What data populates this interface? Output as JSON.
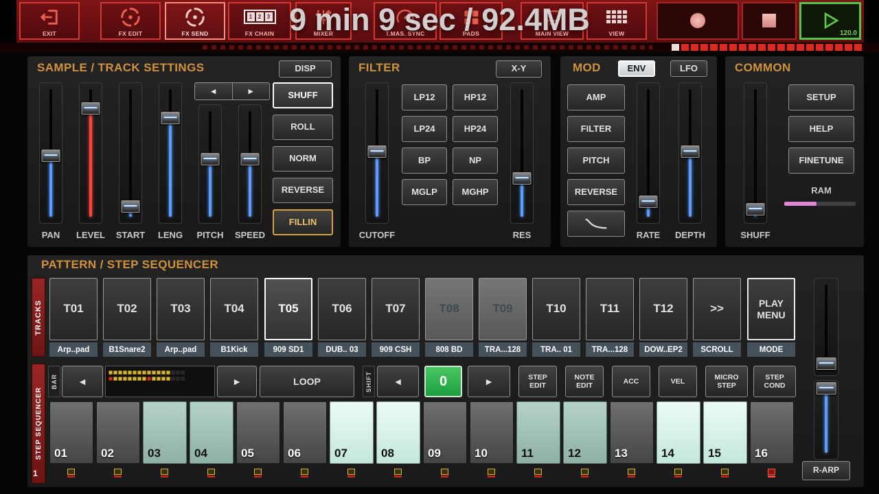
{
  "overlay_text": "9 min 9 sec / 92.4MB",
  "icons": {
    "prev": "◄",
    "next": "►"
  },
  "colors": {
    "accent_orange": "#d0923c",
    "fader_blue": "#5a9cff",
    "level_red": "#ff4438",
    "step_lit": "#d9f3ec",
    "play_green": "#58c24a",
    "ram_pink": "#df86d2",
    "seq_red": "#8e1f1f"
  },
  "toolbar": {
    "buttons": [
      {
        "label": "EXIT",
        "icon": "exit-icon"
      },
      {
        "label": "FX EDIT",
        "icon": "fx-spiral-icon"
      },
      {
        "label": "FX SEND",
        "icon": "fx-spiral-icon",
        "state": "active"
      },
      {
        "label": "FX CHAIN",
        "icon": "fx-chain-123-icon"
      },
      {
        "label": "MIXER",
        "icon": "mixer-faders-icon"
      },
      {
        "label": "T.MAS. SYNC",
        "icon": "gauge-icon"
      },
      {
        "label": "PADS",
        "icon": "pads-grid-icon"
      },
      {
        "label": "MAIN VIEW",
        "icon": "monitor-icon"
      },
      {
        "label": "VIEW",
        "icon": "view-grid-icon"
      }
    ],
    "play": {
      "bpm": "120.0"
    }
  },
  "sample": {
    "title": "SAMPLE / TRACK SETTINGS",
    "disp_label": "DISP",
    "faders": [
      {
        "label": "PAN",
        "pos": 52,
        "color": "#5a9cff"
      },
      {
        "label": "LEVEL",
        "pos": 18,
        "color": "#ff4438"
      },
      {
        "label": "START",
        "pos": 88,
        "color": "#5a9cff"
      },
      {
        "label": "LENG",
        "pos": 25,
        "color": "#5a9cff"
      },
      {
        "label": "PITCH",
        "pos": 46,
        "color": "#5a9cff"
      },
      {
        "label": "SPEED",
        "pos": 46,
        "color": "#5a9cff"
      }
    ],
    "buttons": [
      {
        "label": "SHUFF",
        "state": "selected"
      },
      {
        "label": "ROLL"
      },
      {
        "label": "NORM"
      },
      {
        "label": "REVERSE"
      },
      {
        "label": "FILLIN",
        "state": "accent"
      }
    ]
  },
  "filter": {
    "title": "FILTER",
    "xy_label": "X-Y",
    "cutoff": {
      "label": "CUTOFF",
      "pos": 49,
      "color": "#5a9cff"
    },
    "res": {
      "label": "RES",
      "pos": 68,
      "color": "#5a9cff"
    },
    "types": [
      "LP12",
      "HP12",
      "LP24",
      "HP24",
      "BP",
      "NP",
      "MGLP",
      "MGHP"
    ]
  },
  "mod": {
    "title": "MOD",
    "env_label": "ENV",
    "lfo_label": "LFO",
    "env_selected": true,
    "targets": [
      "AMP",
      "FILTER",
      "PITCH",
      "REVERSE"
    ],
    "rate": {
      "label": "RATE",
      "pos": 85,
      "color": "#5a9cff"
    },
    "depth": {
      "label": "DEPTH",
      "pos": 49,
      "color": "#5a9cff"
    }
  },
  "common": {
    "title": "COMMON",
    "buttons": [
      "SETUP",
      "HELP",
      "FINETUNE"
    ],
    "ram_label": "RAM",
    "ram_pct": 45,
    "shuff": {
      "label": "SHUFF",
      "pos": 90,
      "color": "#5a9cff"
    }
  },
  "pattern": {
    "title": "PATTERN / STEP SEQUENCER",
    "tracks_label": "TRACKS",
    "seq_label": "STEP SEQUENCER",
    "tracks": [
      {
        "id": "T01",
        "name": "Arp..pad"
      },
      {
        "id": "T02",
        "name": "B1Snare2"
      },
      {
        "id": "T03",
        "name": "Arp..pad"
      },
      {
        "id": "T04",
        "name": "B1Kick"
      },
      {
        "id": "T05",
        "name": "909 SD1",
        "state": "selected"
      },
      {
        "id": "T06",
        "name": "DUB.. 03"
      },
      {
        "id": "T07",
        "name": "909 CSH"
      },
      {
        "id": "T08",
        "name": "808 BD",
        "state": "muted"
      },
      {
        "id": "T09",
        "name": "TRA...128",
        "state": "muted"
      },
      {
        "id": "T10",
        "name": "TRA.. 01"
      },
      {
        "id": "T11",
        "name": "TRA...128"
      },
      {
        "id": "T12",
        "name": "DOW..EP2"
      }
    ],
    "scroll_btn": {
      "id": ">>",
      "name": "SCROLL"
    },
    "mode_btn": {
      "id": "PLAY MENU",
      "name": "MODE"
    },
    "bar_label": "BAR",
    "loop_label": "LOOP",
    "shift_label": "SHIFT",
    "shift_value": "0",
    "tools": [
      "STEP EDIT",
      "NOTE EDIT",
      "ACC",
      "VEL",
      "MICRO STEP",
      "STEP COND"
    ],
    "bar_number": "1",
    "rarp_label": "R-ARP",
    "steps": [
      {
        "n": "01",
        "state": "off"
      },
      {
        "n": "02",
        "state": "off"
      },
      {
        "n": "03",
        "state": "dim"
      },
      {
        "n": "04",
        "state": "dim"
      },
      {
        "n": "05",
        "state": "off"
      },
      {
        "n": "06",
        "state": "off"
      },
      {
        "n": "07",
        "state": "on"
      },
      {
        "n": "08",
        "state": "on"
      },
      {
        "n": "09",
        "state": "off"
      },
      {
        "n": "10",
        "state": "off"
      },
      {
        "n": "11",
        "state": "dim"
      },
      {
        "n": "12",
        "state": "dim"
      },
      {
        "n": "13",
        "state": "off"
      },
      {
        "n": "14",
        "state": "on"
      },
      {
        "n": "15",
        "state": "on"
      },
      {
        "n": "16",
        "state": "off"
      }
    ],
    "step_indicators": [
      "y",
      "y",
      "y",
      "y",
      "y",
      "y",
      "y",
      "y",
      "y",
      "y",
      "y",
      "y",
      "y",
      "y",
      "y",
      "r"
    ],
    "overview_grid": [
      [
        "y",
        "y",
        "y",
        "y",
        "y",
        "y",
        "y",
        "y",
        "y",
        "y",
        "y",
        "y",
        "y",
        "d",
        "d",
        "d"
      ],
      [
        "r",
        "y",
        "y",
        "y",
        "y",
        "y",
        "y",
        "y",
        "r",
        "y",
        "y",
        "y",
        "y",
        "d",
        "d",
        "d"
      ]
    ],
    "tracks_fader": {
      "pos": 88,
      "color": ""
    },
    "steps_fader": {
      "pos": 10,
      "color": "#5a9cff"
    }
  }
}
